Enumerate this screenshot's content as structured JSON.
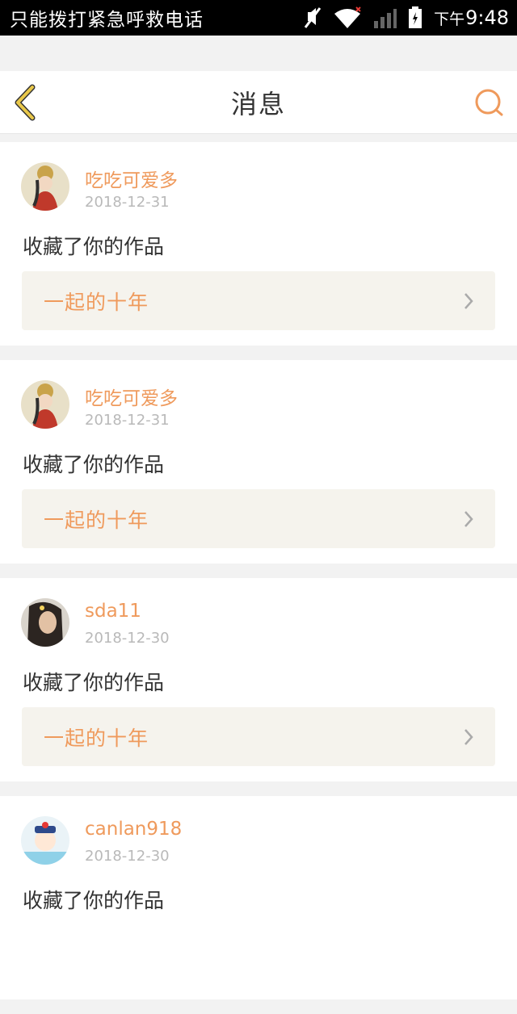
{
  "status_bar": {
    "left_text": "只能拨打紧急呼救电话",
    "time_prefix": "下午",
    "time": "9:48",
    "icons": [
      "mute-icon",
      "wifi-icon",
      "signal-icon",
      "battery-icon"
    ]
  },
  "header": {
    "title": "消息",
    "back_icon": "chevron-left-icon",
    "search_icon": "search-icon",
    "accent_color": "#ef9a5c",
    "back_color": "#e9c84a"
  },
  "messages": [
    {
      "username": "吃吃可爱多",
      "date": "2018-12-31",
      "action": "收藏了你的作品",
      "work_title": "一起的十年",
      "avatar": "avatar-illustrated-woman"
    },
    {
      "username": "吃吃可爱多",
      "date": "2018-12-31",
      "action": "收藏了你的作品",
      "work_title": "一起的十年",
      "avatar": "avatar-illustrated-woman"
    },
    {
      "username": "sda11",
      "date": "2018-12-30",
      "action": "收藏了你的作品",
      "work_title": "一起的十年",
      "avatar": "avatar-photo-woman"
    },
    {
      "username": "canlan918",
      "date": "2018-12-30",
      "action": "收藏了你的作品",
      "work_title": "",
      "avatar": "avatar-cartoon-character"
    }
  ]
}
